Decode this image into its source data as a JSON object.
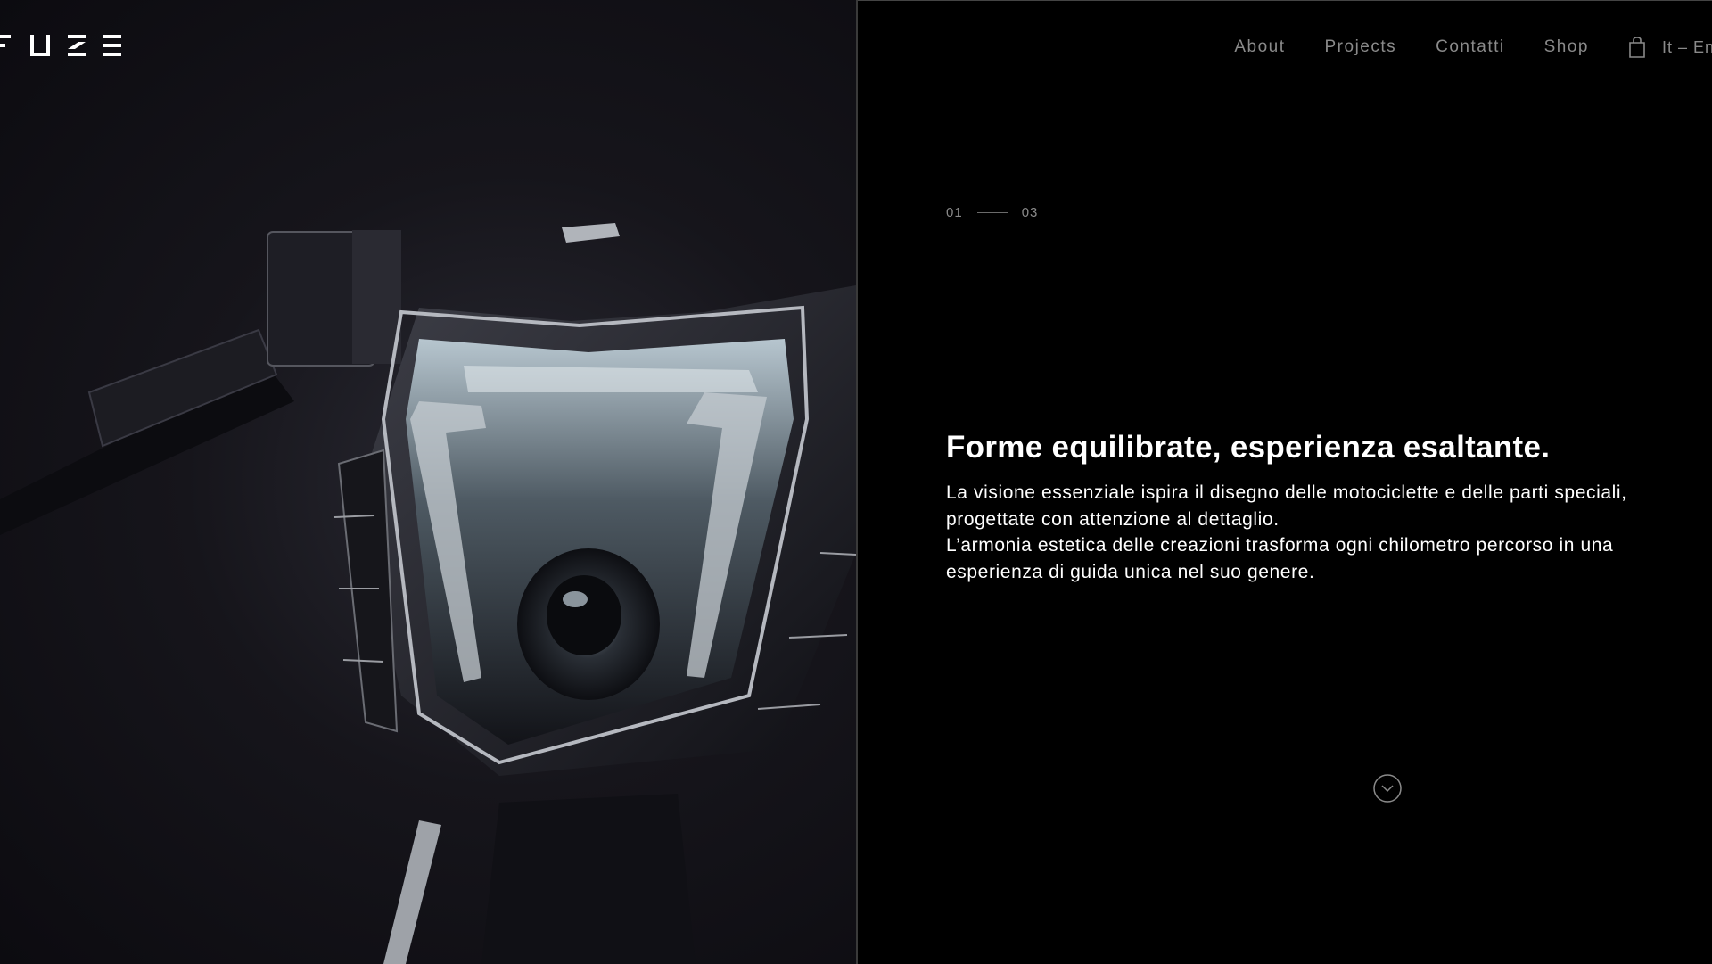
{
  "brand": {
    "logo_text": "FUZE",
    "logo_icon": "fuze-logo"
  },
  "nav": {
    "items": [
      {
        "label": "About"
      },
      {
        "label": "Projects"
      },
      {
        "label": "Contatti"
      },
      {
        "label": "Shop"
      }
    ],
    "cart_icon": "shopping-bag-icon",
    "language": "It – En"
  },
  "hero": {
    "image_alt": "motorcycle-headlight-photo",
    "slide_current": "01",
    "slide_total": "03",
    "headline": "Forme equilibrate, esperienza esaltante.",
    "paragraphs": [
      "La visione essenziale ispira il disegno delle motociclette e delle parti speciali, progettate con attenzione al dettaglio.",
      "L’armonia estetica delle creazioni trasforma ogni chilometro percorso in una esperienza di guida unica nel suo genere."
    ],
    "scroll_icon": "chevron-down-circle-icon"
  },
  "colors": {
    "background": "#000000",
    "text": "#ffffff",
    "muted": "#8a8a8a"
  }
}
